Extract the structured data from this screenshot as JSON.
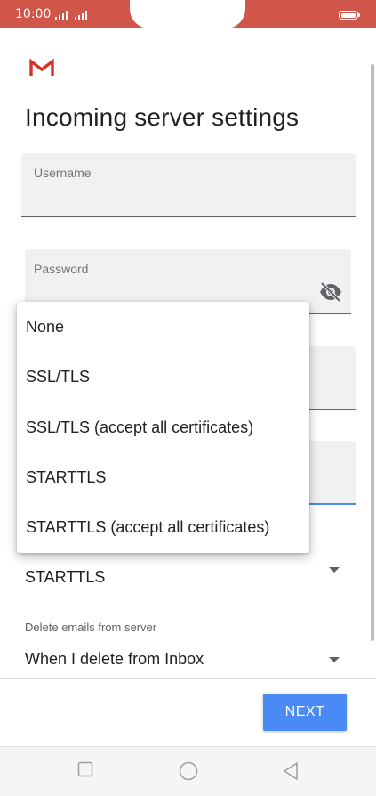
{
  "status_bar": {
    "time": "10:00",
    "accent_color": "#d0564a"
  },
  "app": {
    "logo_icon": "gmail-logo-icon"
  },
  "page": {
    "title": "Incoming server settings"
  },
  "fields": {
    "username_label": "Username",
    "password_label": "Password"
  },
  "security_type": {
    "selected": "STARTTLS",
    "options": [
      "None",
      "SSL/TLS",
      "SSL/TLS (accept all certificates)",
      "STARTTLS",
      "STARTTLS (accept all certificates)"
    ]
  },
  "delete_emails": {
    "caption": "Delete emails from server",
    "selected": "When I delete from Inbox"
  },
  "actions": {
    "next_label": "NEXT",
    "next_color": "#4a8af4"
  },
  "nav": {
    "icons": [
      "recent-apps-icon",
      "home-icon",
      "back-icon"
    ]
  }
}
